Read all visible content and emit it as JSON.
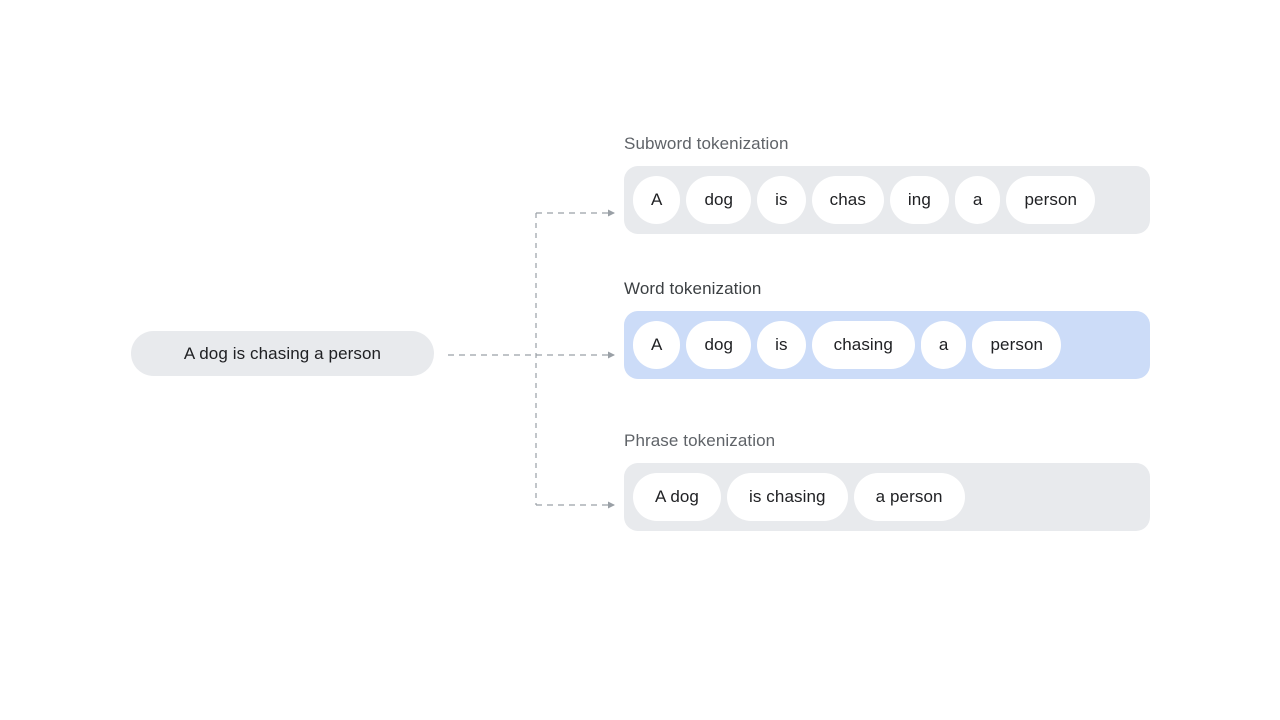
{
  "source": {
    "text": "A dog is chasing a person"
  },
  "colors": {
    "container_gray": "#e8eaed",
    "container_blue": "#ccdcf8",
    "token_bg": "#ffffff",
    "text_primary": "#202124",
    "label_muted": "#5f6368",
    "label_emphasis": "#3c4043",
    "connector": "#9aa0a6"
  },
  "groups": [
    {
      "id": "subword",
      "label": "Subword tokenization",
      "highlighted": false,
      "tokens": [
        "A",
        "dog",
        "is",
        "chas",
        "ing",
        "a",
        "person"
      ]
    },
    {
      "id": "word",
      "label": "Word tokenization",
      "highlighted": true,
      "tokens": [
        "A",
        "dog",
        "is",
        "chasing",
        "a",
        "person"
      ]
    },
    {
      "id": "phrase",
      "label": "Phrase tokenization",
      "highlighted": false,
      "tokens": [
        "A dog",
        "is chasing",
        "a person"
      ]
    }
  ]
}
